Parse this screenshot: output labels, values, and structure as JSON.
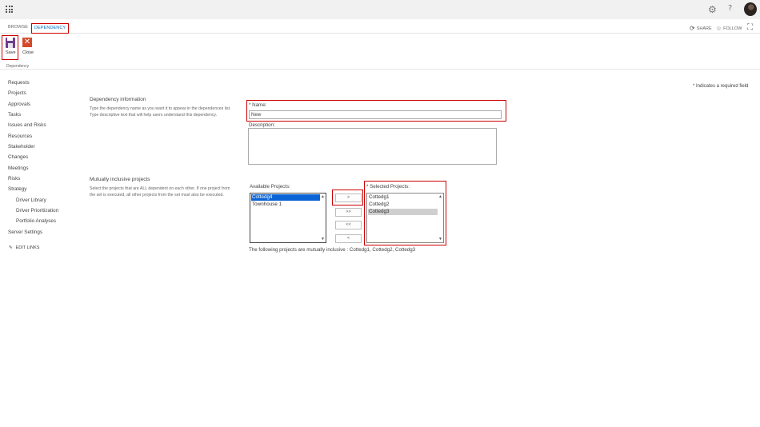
{
  "suite": {
    "help_glyph": "?",
    "gear_glyph": "⚙"
  },
  "ribbon": {
    "tabs": [
      "BROWSE",
      "DEPENDENCY"
    ],
    "share_label": "SHARE",
    "follow_label": "FOLLOW",
    "save_label": "Save",
    "close_label": "Close",
    "group_label": "Dependency"
  },
  "nav": {
    "items": [
      "Requests",
      "Projects",
      "Approvals",
      "Tasks",
      "Issues and Risks",
      "Resources",
      "Stakeholder",
      "Changes",
      "Meetings",
      "Risks",
      "Strategy"
    ],
    "strategy_sub": [
      "Driver Library",
      "Driver Prioritization",
      "Portfolio Analyses"
    ],
    "server_settings": "Server Settings",
    "edit_links": "EDIT LINKS"
  },
  "form": {
    "required_note": "* Indicates a required field",
    "dependency_info": {
      "title": "Dependency information",
      "description": "Type the dependency name as you want it to appear in the dependences list. Type descriptive text that will help users understand this dependency."
    },
    "name_label": "* Name:",
    "name_value": "New",
    "description_label": "Description:",
    "description_value": "",
    "mutual": {
      "title": "Mutually inclusive projects",
      "description": "Select the projects that are ALL dependent on each other. If one project from the set is executed, all other projects from the set must also be executed."
    },
    "available_label": "Available Projects:",
    "available_projects": [
      "Cottedg4",
      "Townhouse 1"
    ],
    "selected_label": "* Selected Projects:",
    "selected_projects": [
      "Cottedg1",
      "Cottedg2",
      "Cottedg3"
    ],
    "buttons": {
      "add": ">",
      "add_all": ">>",
      "remove_all": "<<",
      "remove": "<"
    },
    "inclusive_text": "The following projects are mutually inclusive : Cottedg1, Cottedg2, Cottedg3"
  },
  "colors": {
    "highlight_border": "#cc0000",
    "selection_blue": "#0a64d6",
    "save_icon": "#6c3f8c",
    "close_icon": "#d4492c"
  }
}
